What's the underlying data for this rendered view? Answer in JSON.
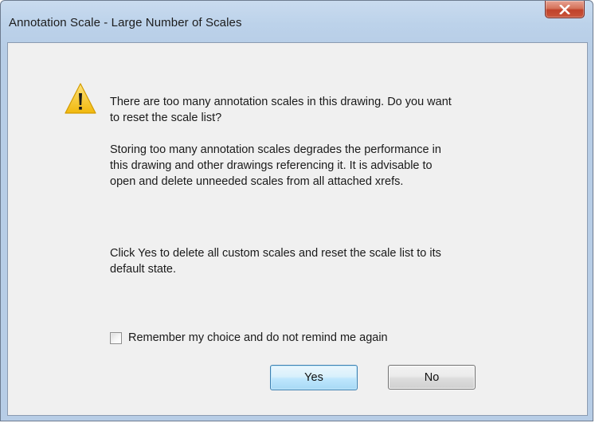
{
  "window": {
    "title": "Annotation Scale - Large Number of Scales"
  },
  "dialog": {
    "icon": "warning-icon",
    "question": "There are too many annotation scales in this drawing. Do you want\nto reset the scale list?",
    "detail": "Storing too many annotation scales degrades the performance in\nthis drawing and other drawings referencing it. It is advisable to\nopen and delete unneeded scales from all attached xrefs.",
    "instruction": "Click Yes to delete all custom scales and reset the scale list to its\ndefault state.",
    "remember_label": "Remember my choice and do not remind me again",
    "remember_checked": false
  },
  "buttons": {
    "yes_label": "Yes",
    "no_label": "No"
  },
  "colors": {
    "warning_yellow": "#f5c211",
    "close_red": "#c9553b",
    "default_button_border": "#3c7fb1"
  }
}
